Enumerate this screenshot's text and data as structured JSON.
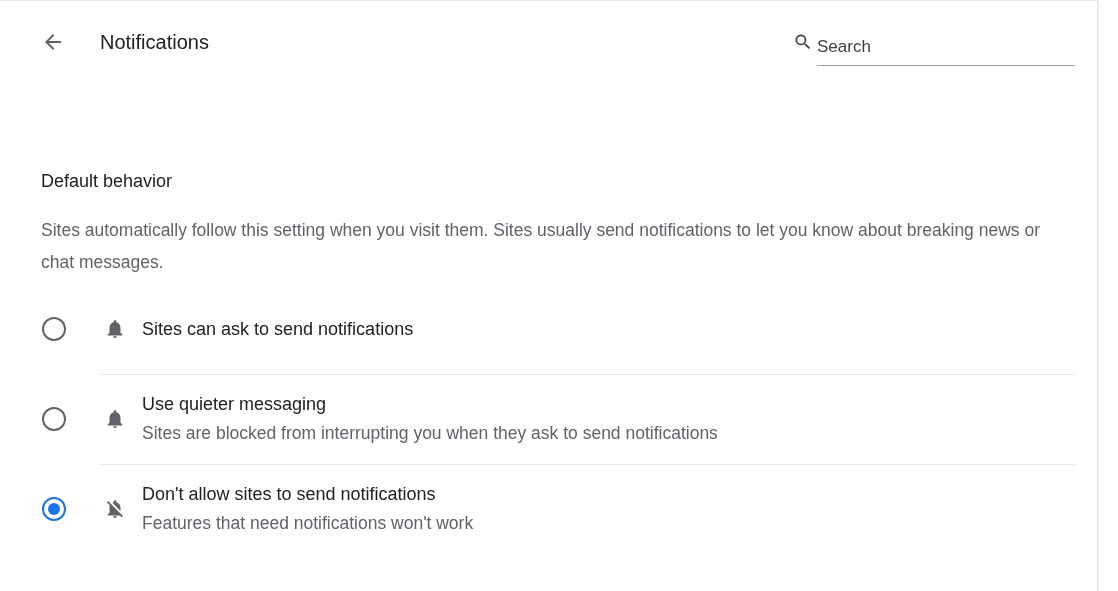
{
  "header": {
    "title": "Notifications",
    "search": {
      "placeholder": "Search"
    }
  },
  "section": {
    "title": "Default behavior",
    "description": "Sites automatically follow this setting when you visit them. Sites usually send notifications to let you know about breaking news or chat messages.",
    "options": [
      {
        "kind": "bell",
        "label": "Sites can ask to send notifications",
        "selected": false
      },
      {
        "kind": "bell",
        "label": "Use quieter messaging",
        "sublabel": "Sites are blocked from interrupting you when they ask to send notifications",
        "selected": false
      },
      {
        "kind": "bell-off",
        "label": "Don't allow sites to send notifications",
        "sublabel": "Features that need notifications won't work",
        "selected": true
      }
    ]
  }
}
